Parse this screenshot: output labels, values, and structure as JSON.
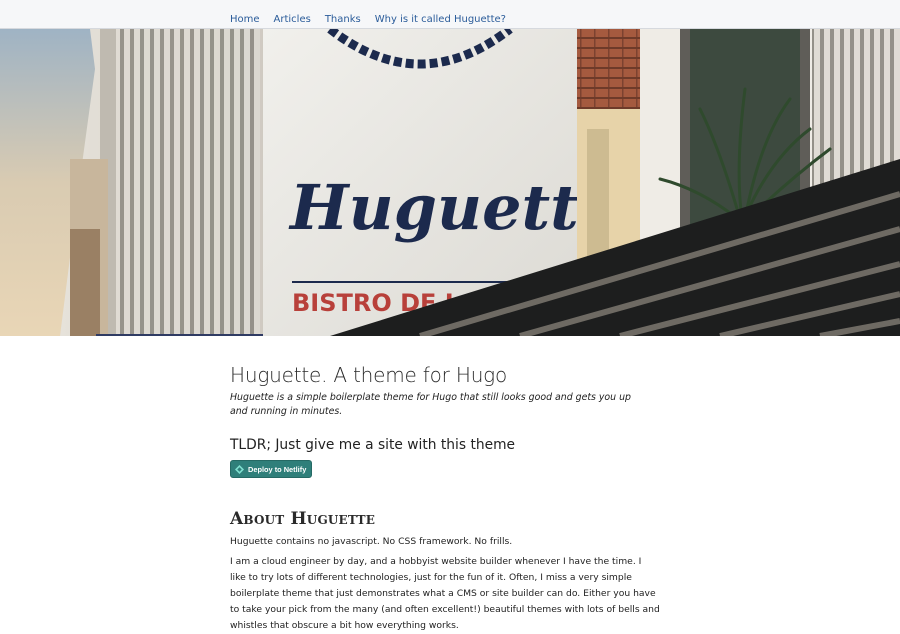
{
  "nav": {
    "items": [
      {
        "label": "Home"
      },
      {
        "label": "Articles"
      },
      {
        "label": "Thanks"
      },
      {
        "label": "Why is it called Huguette?"
      }
    ]
  },
  "hero": {
    "sign_script": "Huguette",
    "sign_text": "BISTRO DE L"
  },
  "main": {
    "title": "Huguette. A theme for Hugo",
    "intro": "Huguette is a simple boilerplate theme for Hugo that still looks good and gets you up and running in minutes.",
    "tldr_heading": "TLDR; Just give me a site with this theme",
    "deploy_label": "Deploy to Netlify",
    "about_heading": "About Huguette",
    "about_p1": "Huguette contains no javascript. No CSS framework. No frills.",
    "about_p2": "I am a cloud engineer by day, and a hobbyist website builder whenever I have the time. I like to try lots of different technologies, just for the fun of it. Often, I miss a very simple boilerplate theme that just demonstrates what a CMS or site builder can do. Either you have to take your pick from the many (and often excellent!) beautiful themes with lots of bells and whistles that obscure a bit how everything works."
  },
  "colors": {
    "nav_bg": "#f6f7f9",
    "link": "#2b5c9a",
    "button": "#2f7f7a"
  }
}
